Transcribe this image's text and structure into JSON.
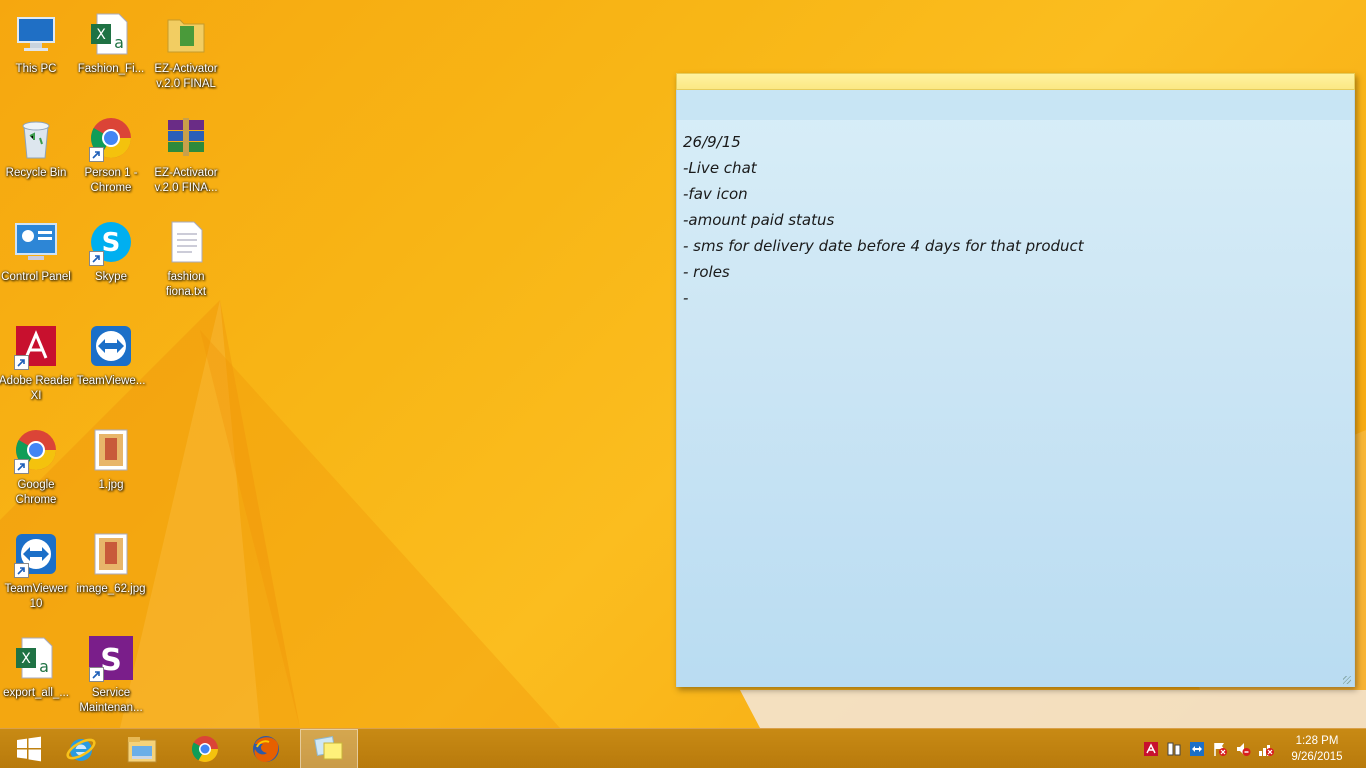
{
  "desktop_icons": [
    {
      "name": "this-pc-icon",
      "label": "This PC",
      "shortcut": false
    },
    {
      "name": "excel-file-icon",
      "label": "Fashion_Fi...",
      "shortcut": false
    },
    {
      "name": "folder-icon",
      "label": "EZ-Activator v.2.0 FINAL",
      "shortcut": false
    },
    {
      "name": "recycle-bin-icon",
      "label": "Recycle Bin",
      "shortcut": false
    },
    {
      "name": "chrome-icon",
      "label": "Person 1 - Chrome",
      "shortcut": true
    },
    {
      "name": "winrar-archive-icon",
      "label": "EZ-Activator v.2.0 FINA...",
      "shortcut": false
    },
    {
      "name": "control-panel-icon",
      "label": "Control Panel",
      "shortcut": false
    },
    {
      "name": "skype-icon",
      "label": "Skype",
      "shortcut": true
    },
    {
      "name": "text-file-icon",
      "label": "fashion fiona.txt",
      "shortcut": false
    },
    {
      "name": "adobe-reader-icon",
      "label": "Adobe Reader XI",
      "shortcut": true
    },
    {
      "name": "teamviewer-icon",
      "label": "TeamViewe...",
      "shortcut": false
    },
    {
      "name": "google-chrome-icon",
      "label": "Google Chrome",
      "shortcut": true
    },
    {
      "name": "jpg-image-icon",
      "label": "1.jpg",
      "shortcut": false
    },
    {
      "name": "teamviewer10-icon",
      "label": "TeamViewer 10",
      "shortcut": true
    },
    {
      "name": "jpg-image-icon",
      "label": "image_62.jpg",
      "shortcut": false
    },
    {
      "name": "excel-file-icon",
      "label": "export_all_...",
      "shortcut": false
    },
    {
      "name": "service-maintenance-icon",
      "label": "Service Maintenan...",
      "shortcut": true
    }
  ],
  "sticky_note": {
    "lines": [
      "26/9/15",
      "-Live chat",
      "-fav icon",
      "-amount paid status",
      "- sms for delivery date before 4 days for that product",
      "- roles",
      "-"
    ]
  },
  "taskbar": {
    "buttons": [
      {
        "name": "start-button",
        "icon": "windows-logo-icon"
      },
      {
        "name": "internet-explorer-button",
        "icon": "ie-icon"
      },
      {
        "name": "file-explorer-button",
        "icon": "file-explorer-icon"
      },
      {
        "name": "chrome-taskbar-button",
        "icon": "chrome-icon"
      },
      {
        "name": "firefox-button",
        "icon": "firefox-icon"
      },
      {
        "name": "sticky-notes-button",
        "icon": "sticky-notes-icon",
        "active": true
      }
    ],
    "tray_icons": [
      "adobe-tray-icon",
      "device-tray-icon",
      "teamviewer-tray-icon",
      "flag-alert-icon",
      "speaker-muted-icon",
      "network-disconnected-icon"
    ],
    "clock_time": "1:28 PM",
    "clock_date": "9/26/2015"
  },
  "colors": {
    "desktop_bg": "#f8b616",
    "taskbar_bg": "#c0820f",
    "sticky_bg": "#cde6f4"
  }
}
